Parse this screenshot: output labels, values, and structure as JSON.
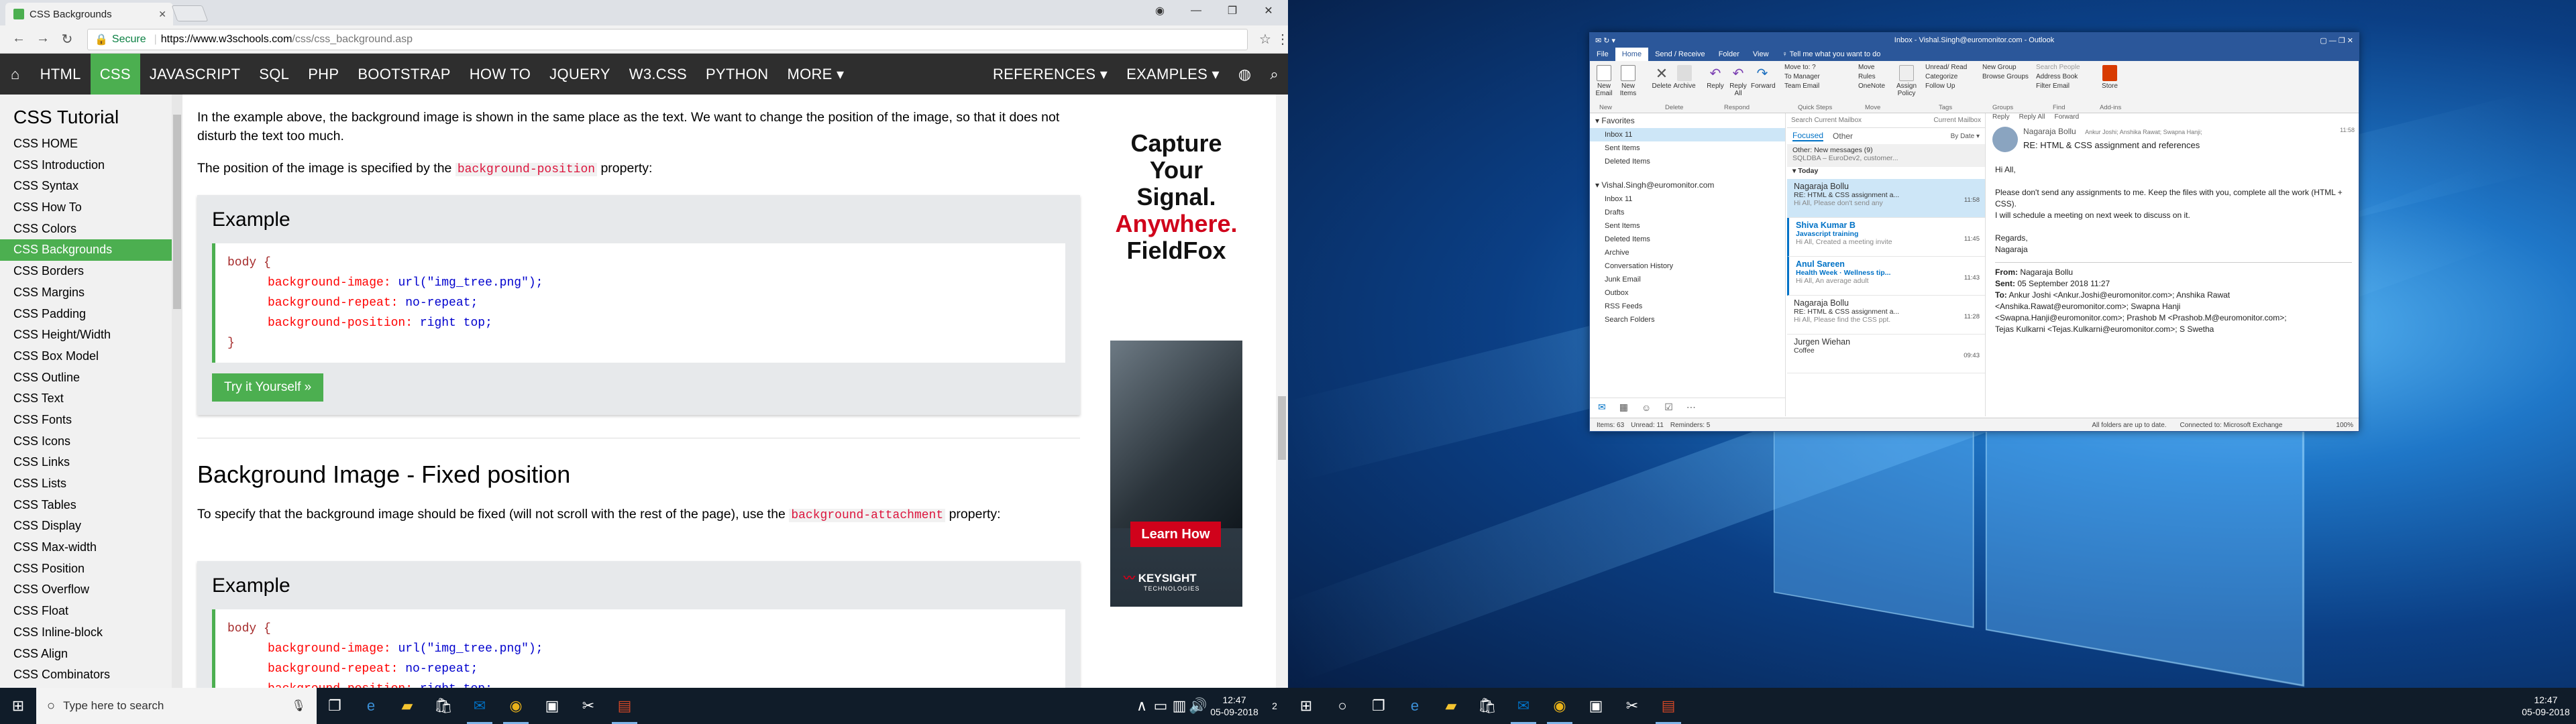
{
  "browser": {
    "tab_title": "CSS Backgrounds",
    "secure_label": "Secure",
    "url_domain": "https://www.w3schools.com",
    "url_path": "/css/css_background.asp"
  },
  "w3nav": {
    "items": [
      "HTML",
      "CSS",
      "JAVASCRIPT",
      "SQL",
      "PHP",
      "BOOTSTRAP",
      "HOW TO",
      "JQUERY",
      "W3.CSS",
      "PYTHON",
      "MORE ▾"
    ],
    "right_items": [
      "REFERENCES ▾",
      "EXAMPLES ▾"
    ]
  },
  "sidebar": {
    "title": "CSS Tutorial",
    "items": [
      "CSS HOME",
      "CSS Introduction",
      "CSS Syntax",
      "CSS How To",
      "CSS Colors",
      "CSS Backgrounds",
      "CSS Borders",
      "CSS Margins",
      "CSS Padding",
      "CSS Height/Width",
      "CSS Box Model",
      "CSS Outline",
      "CSS Text",
      "CSS Fonts",
      "CSS Icons",
      "CSS Links",
      "CSS Lists",
      "CSS Tables",
      "CSS Display",
      "CSS Max-width",
      "CSS Position",
      "CSS Overflow",
      "CSS Float",
      "CSS Inline-block",
      "CSS Align",
      "CSS Combinators"
    ],
    "active_index": 5
  },
  "content": {
    "p1": "In the example above, the background image is shown in the same place as the text. We want to change the position of the image, so that it does not disturb the text too much.",
    "p2_pre": "The position of the image is specified by the ",
    "p2_code": "background-position",
    "p2_post": " property:",
    "example_title": "Example",
    "ex1": {
      "selector": "body {",
      "l1p": "background-image:",
      "l1v": " url(\"img_tree.png\");",
      "l2p": "background-repeat:",
      "l2v": " no-repeat;",
      "l3p": "background-position:",
      "l3v": " right top;",
      "close": "}"
    },
    "tryit": "Try it Yourself »",
    "h2": "Background Image - Fixed position",
    "p3_pre": "To specify that the background image should be fixed (will not scroll with the rest of the page), use the ",
    "p3_code": "background-attachment",
    "p3_post": " property:",
    "ex2": {
      "selector": "body {",
      "l1p": "background-image:",
      "l1v": " url(\"img_tree.png\");",
      "l2p": "background-repeat:",
      "l2v": " no-repeat;",
      "l3p": "background-position:",
      "l3v": " right top;"
    }
  },
  "ad": {
    "line1": "Capture",
    "line2": "Your Signal.",
    "line3": "Anywhere.",
    "line4": "FieldFox",
    "cta": "Learn How",
    "brand": "KEYSIGHT",
    "brand_sub": "TECHNOLOGIES"
  },
  "taskbar_left": {
    "search_placeholder": "Type here to search",
    "time": "12:47",
    "date": "05-09-2018",
    "notif": "2"
  },
  "taskbar_right": {
    "time": "12:47",
    "date": "05-09-2018"
  },
  "outlook": {
    "title": "Inbox - Vishal.Singh@euromonitor.com - Outlook",
    "menu": [
      "File",
      "Home",
      "Send / Receive",
      "Folder",
      "View",
      "♀ Tell me what you want to do"
    ],
    "ribbon": {
      "new_email": "New Email",
      "new_items": "New Items",
      "delete": "Delete",
      "archive": "Archive",
      "reply": "Reply",
      "reply_all": "Reply All",
      "forward": "Forward",
      "move_to": "Move to: ?",
      "to_manager": "To Manager",
      "team_email": "Team Email",
      "move": "Move",
      "rules": "Rules",
      "onenote": "OneNote",
      "assign_policy": "Assign Policy",
      "unread_read": "Unread/ Read",
      "categorize": "Categorize",
      "follow_up": "Follow Up",
      "new_group": "New Group",
      "browse_groups": "Browse Groups",
      "search_people": "Search People",
      "address_book": "Address Book",
      "filter_email": "Filter Email",
      "store": "Store",
      "groups": [
        "New",
        "Delete",
        "Respond",
        "Quick Steps",
        "Move",
        "Tags",
        "Groups",
        "Find",
        "Add-ins"
      ]
    },
    "nav": {
      "favorites": "Favorites",
      "fav_items": [
        "Inbox  11",
        "Sent Items",
        "Deleted Items"
      ],
      "account": "Vishal.Singh@euromonitor.com",
      "folders": [
        "Inbox  11",
        "Drafts",
        "Sent Items",
        "Deleted Items",
        "Archive",
        "Conversation History",
        "Junk Email",
        "Outbox",
        "RSS Feeds",
        "Search Folders"
      ]
    },
    "list": {
      "search_placeholder": "Search Current Mailbox",
      "scope": "Current Mailbox",
      "focused": "Focused",
      "other": "Other",
      "sort": "By Date ▾",
      "other_banner": "Other: New messages (9)",
      "other_sub": "SQLDBA – EuroDev2, customer...",
      "today": "Today",
      "messages": [
        {
          "from": "Nagaraja Bollu",
          "subject": "RE: HTML & CSS assignment a...",
          "preview": "Hi All,  Please don't send any",
          "time": "11:58",
          "state": "sel"
        },
        {
          "from": "Shiva Kumar B",
          "subject": "Javascript training",
          "preview": "Hi All,  Created a meeting invite",
          "time": "11:45",
          "state": "unread"
        },
        {
          "from": "Anul Sareen",
          "subject": "Health Week · Wellness tip...",
          "preview": "Hi All,  An average adult",
          "time": "11:43",
          "state": "unread"
        },
        {
          "from": "Nagaraja Bollu",
          "subject": "RE: HTML & CSS assignment a...",
          "preview": "Hi All,  Please find the CSS ppt.",
          "time": "11:28",
          "state": ""
        },
        {
          "from": "Jurgen Wiehan",
          "subject": "Coffee",
          "preview": "",
          "time": "09:43",
          "state": ""
        }
      ]
    },
    "read": {
      "actions": [
        "Reply",
        "Reply All",
        "Forward"
      ],
      "sender": "Nagaraja Bollu",
      "recipients": "Ankur Joshi; Anshika Rawat; Swapna Hanji;",
      "time": "11:58",
      "subject": "RE: HTML & CSS assignment and references",
      "greeting": "Hi All,",
      "body1": "Please don't send any assignments to me. Keep the files with you, complete all the work (HTML + CSS).",
      "body2": "I will schedule a meeting on next week to discuss on it.",
      "regards": "Regards,",
      "sign": "Nagaraja",
      "from_label": "From:",
      "from_val": "Nagaraja Bollu",
      "sent_label": "Sent:",
      "sent_val": "05 September 2018 11:27",
      "to_label": "To:",
      "to_val": "Ankur Joshi <Ankur.Joshi@euromonitor.com>; Anshika Rawat",
      "to_val2": "<Anshika.Rawat@euromonitor.com>; Swapna Hanji",
      "to_val3": "<Swapna.Hanji@euromonitor.com>; Prashob M <Prashob.M@euromonitor.com>;",
      "to_val4": "Tejas Kulkarni <Tejas.Kulkarni@euromonitor.com>; S Swetha"
    },
    "status": {
      "items": "Items: 63",
      "unread": "Unread: 11",
      "reminders": "Reminders: 5",
      "sync": "All folders are up to date.",
      "conn": "Connected to: Microsoft Exchange",
      "zoom": "100%"
    }
  }
}
